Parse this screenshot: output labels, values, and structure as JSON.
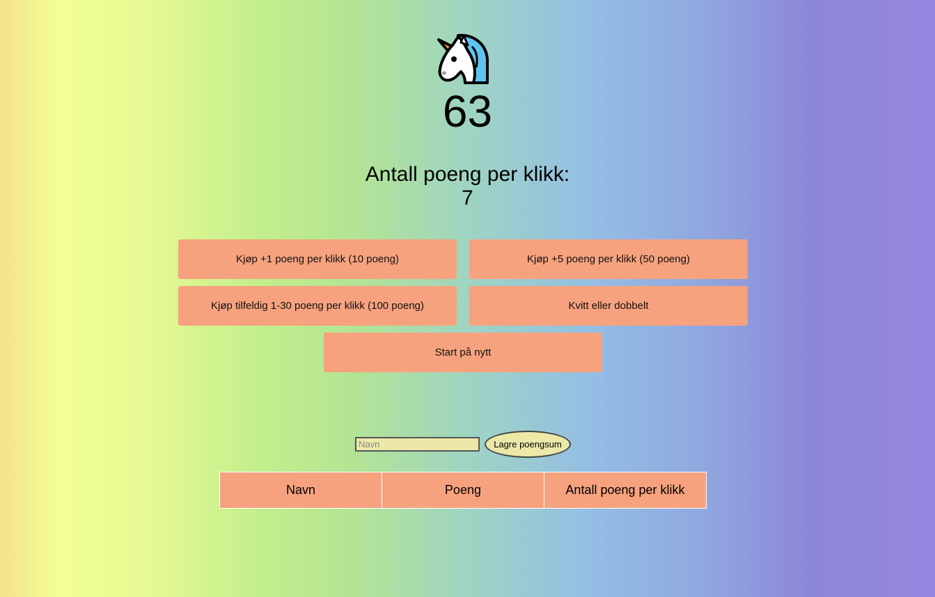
{
  "game": {
    "unicorn_icon": "unicorn-icon",
    "score": "63",
    "points_per_click_label": "Antall poeng per klikk:",
    "points_per_click_value": "7"
  },
  "shop": {
    "buy_plus1": "Kjøp +1 poeng per klikk (10 poeng)",
    "buy_plus5": "Kjøp +5 poeng per klikk (50 poeng)",
    "buy_random": "Kjøp tilfeldig 1-30 poeng per klikk (100 poeng)",
    "double_or_nothing": "Kvitt eller dobbelt",
    "restart": "Start på nytt"
  },
  "save": {
    "name_placeholder": "Navn",
    "name_value": "",
    "save_label": "Lagre poengsum"
  },
  "highscores": {
    "columns": [
      "Navn",
      "Poeng",
      "Antall poeng per klikk"
    ],
    "rows": []
  },
  "colors": {
    "button": "#f7a27e",
    "input_bg": "#ece8a8"
  }
}
